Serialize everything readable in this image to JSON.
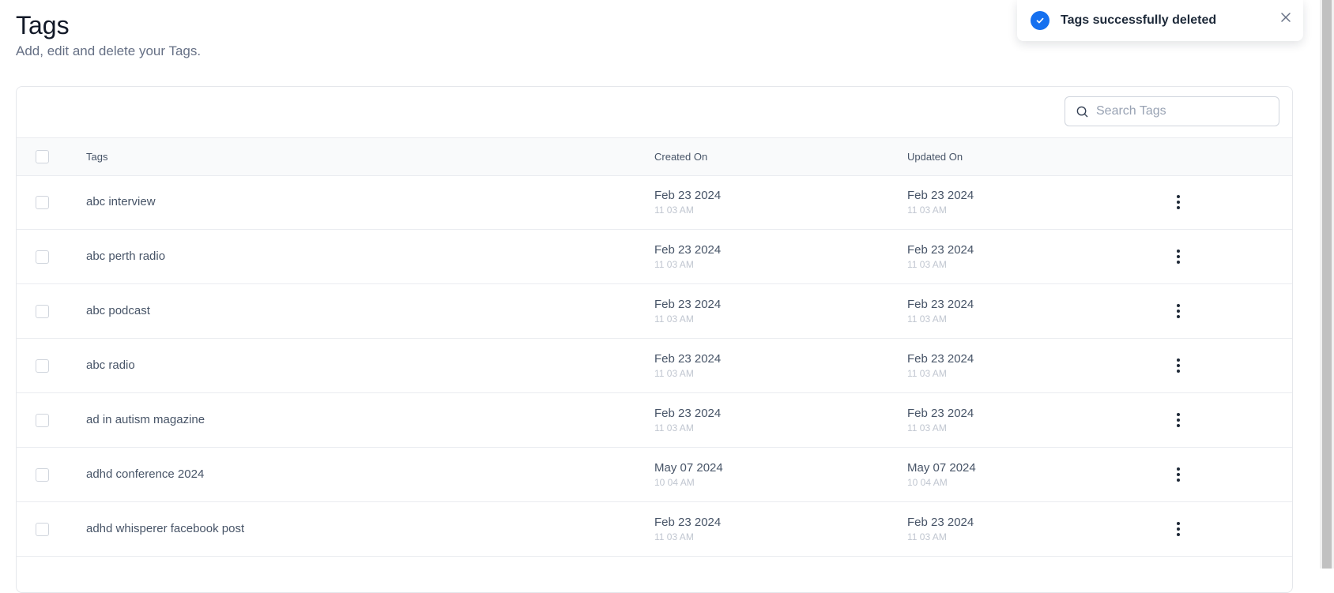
{
  "header": {
    "title": "Tags",
    "subtitle": "Add, edit and delete your Tags."
  },
  "search": {
    "placeholder": "Search Tags",
    "value": ""
  },
  "table": {
    "columns": {
      "tags": "Tags",
      "created": "Created On",
      "updated": "Updated On"
    },
    "rows": [
      {
        "tag": "abc interview",
        "created_date": "Feb 23 2024",
        "created_time": "11 03 AM",
        "updated_date": "Feb 23 2024",
        "updated_time": "11 03 AM"
      },
      {
        "tag": "abc perth radio",
        "created_date": "Feb 23 2024",
        "created_time": "11 03 AM",
        "updated_date": "Feb 23 2024",
        "updated_time": "11 03 AM"
      },
      {
        "tag": "abc podcast",
        "created_date": "Feb 23 2024",
        "created_time": "11 03 AM",
        "updated_date": "Feb 23 2024",
        "updated_time": "11 03 AM"
      },
      {
        "tag": "abc radio",
        "created_date": "Feb 23 2024",
        "created_time": "11 03 AM",
        "updated_date": "Feb 23 2024",
        "updated_time": "11 03 AM"
      },
      {
        "tag": "ad in autism magazine",
        "created_date": "Feb 23 2024",
        "created_time": "11 03 AM",
        "updated_date": "Feb 23 2024",
        "updated_time": "11 03 AM"
      },
      {
        "tag": "adhd conference 2024",
        "created_date": "May 07 2024",
        "created_time": "10 04 AM",
        "updated_date": "May 07 2024",
        "updated_time": "10 04 AM"
      },
      {
        "tag": "adhd whisperer facebook post",
        "created_date": "Feb 23 2024",
        "created_time": "11 03 AM",
        "updated_date": "Feb 23 2024",
        "updated_time": "11 03 AM"
      }
    ]
  },
  "toast": {
    "message": "Tags successfully deleted",
    "icon": "check-circle-icon",
    "accent_color": "#1570ef"
  }
}
